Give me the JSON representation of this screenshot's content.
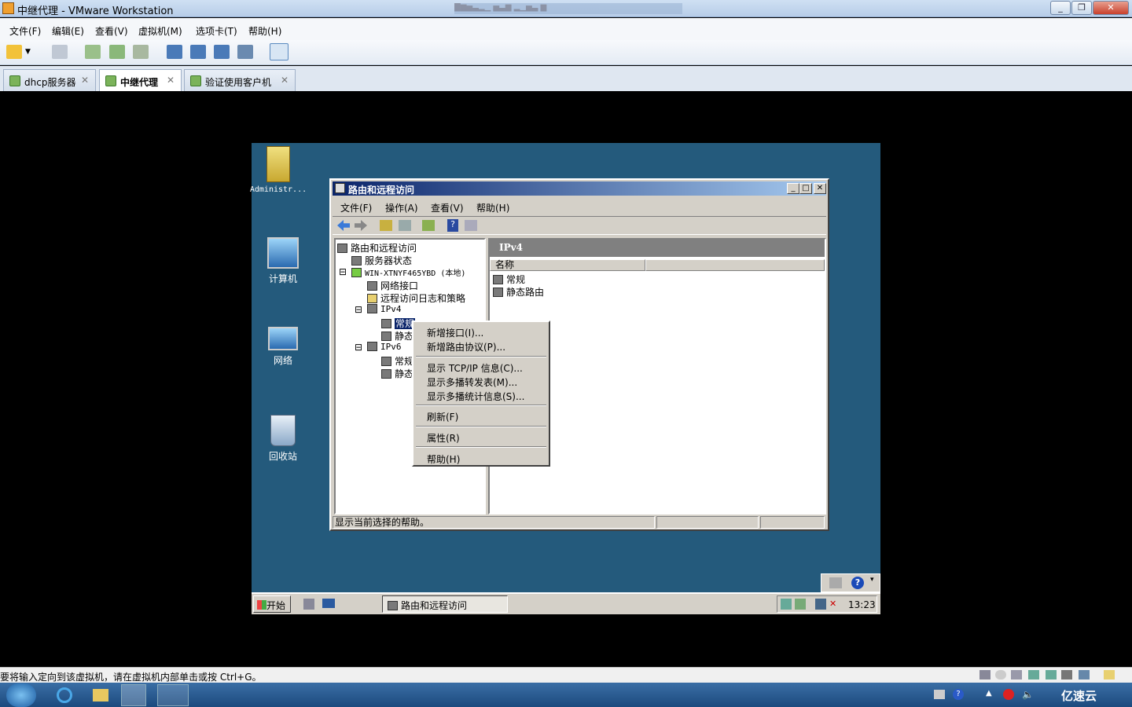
{
  "window": {
    "title": "中继代理 - VMware Workstation",
    "background_title": "█▆▅▃▂▁ ▅▃▆ ▂▁▅▃ ▆"
  },
  "menubar": [
    "文件(F)",
    "编辑(E)",
    "查看(V)",
    "虚拟机(M)",
    "选项卡(T)",
    "帮助(H)"
  ],
  "tabs": [
    {
      "label": "dhcp服务器",
      "active": false
    },
    {
      "label": "中继代理",
      "active": true
    },
    {
      "label": "验证使用客户机",
      "active": false
    }
  ],
  "guest": {
    "desktop_icons": [
      {
        "label": "Administr...",
        "icon": "folder-user-icon"
      },
      {
        "label": "计算机",
        "icon": "computer-icon"
      },
      {
        "label": "网络",
        "icon": "network-icon"
      },
      {
        "label": "回收站",
        "icon": "recycle-bin-icon"
      }
    ],
    "rras": {
      "title": "路由和远程访问",
      "menu": [
        "文件(F)",
        "操作(A)",
        "查看(V)",
        "帮助(H)"
      ],
      "tree": [
        "路由和远程访问",
        "服务器状态",
        "WIN-XTNYF465YBD (本地)",
        "网络接口",
        "远程访问日志和策略",
        "IPv4",
        "常规",
        "静态路由",
        "IPv6",
        "常规",
        "静态路由"
      ],
      "tree_truncated": {
        "ipv4_static": "静态",
        "ipv6_general": "常规",
        "ipv6_static": "静态"
      },
      "right_header": "IPv4",
      "column_name": "名称",
      "list": [
        "常规",
        "静态路由"
      ],
      "status": "显示当前选择的帮助。"
    },
    "context_menu": {
      "group1": [
        "新增接口(I)...",
        "新增路由协议(P)..."
      ],
      "group2": [
        "显示 TCP/IP 信息(C)...",
        "显示多播转发表(M)...",
        "显示多播统计信息(S)..."
      ],
      "group3": [
        "刷新(F)"
      ],
      "group4": [
        "属性(R)"
      ],
      "group5": [
        "帮助(H)"
      ]
    },
    "taskbar": {
      "start": "开始",
      "task": "路由和远程访问",
      "clock": "13:23"
    }
  },
  "vm_status": "要将输入定向到该虚拟机，请在虚拟机内部单击或按 Ctrl+G。",
  "watermark": "亿速云"
}
